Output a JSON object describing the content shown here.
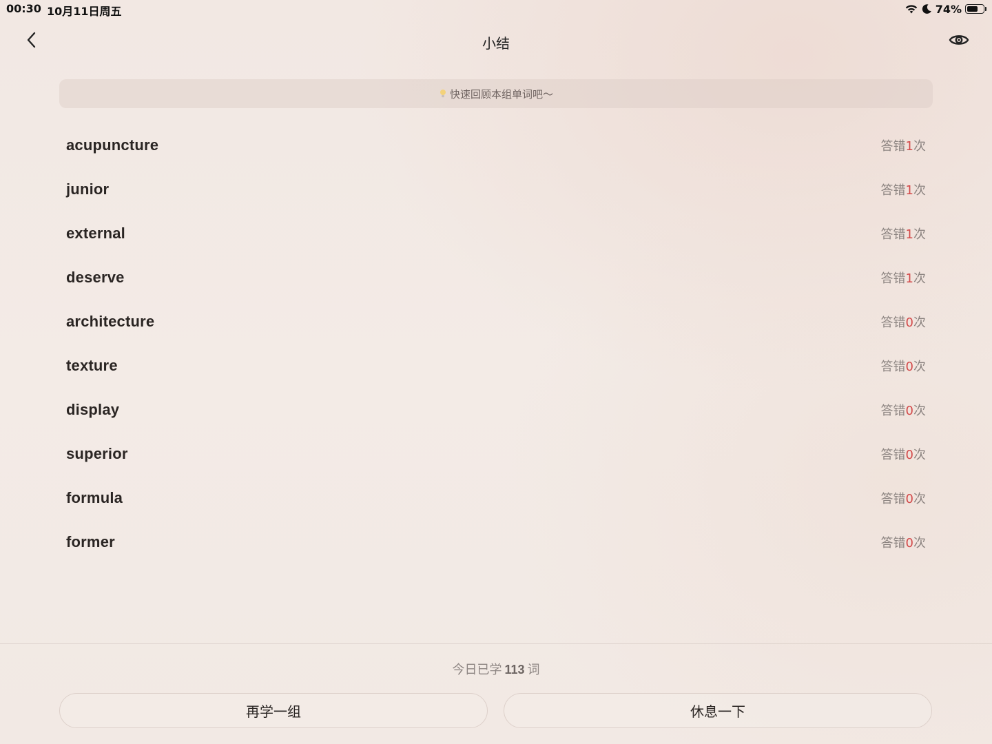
{
  "status_bar": {
    "time": "00:30",
    "date": "10月11日周五",
    "battery_percent": "74%",
    "battery_level": 0.74,
    "icons": [
      "wifi-icon",
      "moon-icon",
      "battery-icon"
    ]
  },
  "nav": {
    "title": "小结",
    "back_icon": "chevron-left-icon",
    "eye_icon": "eye-icon"
  },
  "tip": {
    "text": "快速回顾本组单词吧～",
    "icon": "lightbulb-icon"
  },
  "words": [
    {
      "word": "acupuncture",
      "wrong_prefix": "答错",
      "wrong_count": "1",
      "wrong_suffix": "次"
    },
    {
      "word": "junior",
      "wrong_prefix": "答错",
      "wrong_count": "1",
      "wrong_suffix": "次"
    },
    {
      "word": "external",
      "wrong_prefix": "答错",
      "wrong_count": "1",
      "wrong_suffix": "次"
    },
    {
      "word": "deserve",
      "wrong_prefix": "答错",
      "wrong_count": "1",
      "wrong_suffix": "次"
    },
    {
      "word": "architecture",
      "wrong_prefix": "答错",
      "wrong_count": "0",
      "wrong_suffix": "次"
    },
    {
      "word": "texture",
      "wrong_prefix": "答错",
      "wrong_count": "0",
      "wrong_suffix": "次"
    },
    {
      "word": "display",
      "wrong_prefix": "答错",
      "wrong_count": "0",
      "wrong_suffix": "次"
    },
    {
      "word": "superior",
      "wrong_prefix": "答错",
      "wrong_count": "0",
      "wrong_suffix": "次"
    },
    {
      "word": "formula",
      "wrong_prefix": "答错",
      "wrong_count": "0",
      "wrong_suffix": "次"
    },
    {
      "word": "former",
      "wrong_prefix": "答错",
      "wrong_count": "0",
      "wrong_suffix": "次"
    }
  ],
  "summary": {
    "prefix": "今日已学",
    "count": "113",
    "suffix": "词"
  },
  "buttons": {
    "again": "再学一组",
    "rest": "休息一下"
  },
  "colors": {
    "accent_red": "#d24a4a",
    "text_dark": "#2a2523",
    "text_muted": "#8c8481"
  }
}
